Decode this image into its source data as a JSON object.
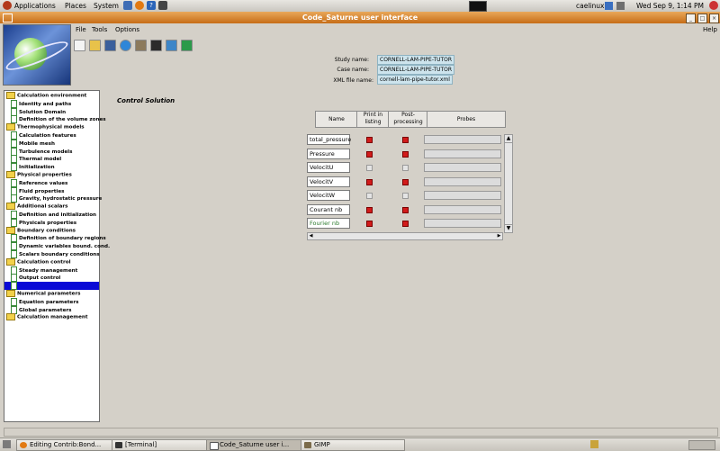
{
  "panel": {
    "menus": [
      "Applications",
      "Places",
      "System"
    ],
    "user": "caelinux",
    "datetime": "Wed Sep  9,  1:14 PM"
  },
  "window": {
    "title": "Code_Saturne user interface"
  },
  "menubar": {
    "items": [
      "File",
      "Tools",
      "Options"
    ],
    "help": "Help"
  },
  "toolbar": {
    "icons": [
      "new-file-icon",
      "open-folder-icon",
      "save-icon",
      "globe-icon",
      "tools-icon",
      "chart-icon",
      "run-icon",
      "export-icon"
    ]
  },
  "study": {
    "study_label": "Study name:",
    "study_value": "CORNELL-LAM-PIPE-TUTOR",
    "case_label": "Case name:",
    "case_value": "CORNELL-LAM-PIPE-TUTOR",
    "xml_label": "XML file name:",
    "xml_value": "cornell-lam-pipe-tutor.xml"
  },
  "tree": [
    {
      "label": "Calculation environment",
      "type": "folder",
      "indent": 0
    },
    {
      "label": "Identity and paths",
      "type": "page",
      "indent": 1
    },
    {
      "label": "Solution Domain",
      "type": "page",
      "indent": 1
    },
    {
      "label": "Definition of the volume zones",
      "type": "page",
      "indent": 1
    },
    {
      "label": "Thermophysical models",
      "type": "folder",
      "indent": 0
    },
    {
      "label": "Calculation features",
      "type": "page",
      "indent": 1
    },
    {
      "label": "Mobile mesh",
      "type": "page",
      "indent": 1
    },
    {
      "label": "Turbulence models",
      "type": "page",
      "indent": 1
    },
    {
      "label": "Thermal model",
      "type": "page",
      "indent": 1
    },
    {
      "label": "Initialization",
      "type": "page",
      "indent": 1
    },
    {
      "label": "Physical properties",
      "type": "folder",
      "indent": 0
    },
    {
      "label": "Reference values",
      "type": "page",
      "indent": 1
    },
    {
      "label": "Fluid properties",
      "type": "page",
      "indent": 1
    },
    {
      "label": "Gravity, hydrostatic pressure",
      "type": "page",
      "indent": 1
    },
    {
      "label": "Additional scalars",
      "type": "folder",
      "indent": 0
    },
    {
      "label": "Definition and initialization",
      "type": "page",
      "indent": 1
    },
    {
      "label": "Physicals properties",
      "type": "page",
      "indent": 1
    },
    {
      "label": "Boundary conditions",
      "type": "folder",
      "indent": 0
    },
    {
      "label": "Definition of boundary regions",
      "type": "page",
      "indent": 1
    },
    {
      "label": "Dynamic variables bound. cond.",
      "type": "page",
      "indent": 1
    },
    {
      "label": "Scalars boundary conditions",
      "type": "page",
      "indent": 1
    },
    {
      "label": "Calculation control",
      "type": "folder",
      "indent": 0
    },
    {
      "label": "Steady management",
      "type": "page",
      "indent": 1
    },
    {
      "label": "Output control",
      "type": "page",
      "indent": 1
    },
    {
      "label": "",
      "type": "page",
      "indent": 1,
      "selected": true
    },
    {
      "label": "Numerical parameters",
      "type": "folder",
      "indent": 0
    },
    {
      "label": "Equation parameters",
      "type": "page",
      "indent": 1
    },
    {
      "label": "Global parameters",
      "type": "page",
      "indent": 1
    },
    {
      "label": "Calculation management",
      "type": "folder",
      "indent": 0
    }
  ],
  "control": {
    "title": "Control Solution",
    "headers": {
      "name": "Name",
      "print": "Print in listing",
      "post": "Post-processing",
      "probes": "Probes"
    },
    "rows": [
      {
        "name": "total_pressure",
        "print": true,
        "post": true
      },
      {
        "name": "Pressure",
        "print": true,
        "post": true
      },
      {
        "name": "VelocitU",
        "print": false,
        "post": false
      },
      {
        "name": "VelocitV",
        "print": true,
        "post": true
      },
      {
        "name": "VelocitW",
        "print": false,
        "post": false
      },
      {
        "name": "Courant nb",
        "print": true,
        "post": true
      },
      {
        "name": "Fourier nb",
        "print": true,
        "post": true
      }
    ]
  },
  "taskbar": {
    "tasks": [
      {
        "label": "Editing Contrib:Bond...",
        "icon": "firefox-icon",
        "active": false
      },
      {
        "label": "[Terminal]",
        "icon": "terminal-icon",
        "active": false
      },
      {
        "label": "Code_Saturne user i...",
        "icon": "window-icon",
        "active": true
      },
      {
        "label": "GIMP",
        "icon": "gimp-icon",
        "active": false
      }
    ]
  },
  "colors": {
    "titlebar": "#c66d17",
    "selection": "#0a0ad6",
    "checked": "#d21b1b",
    "info_bg": "#cde4ed"
  }
}
